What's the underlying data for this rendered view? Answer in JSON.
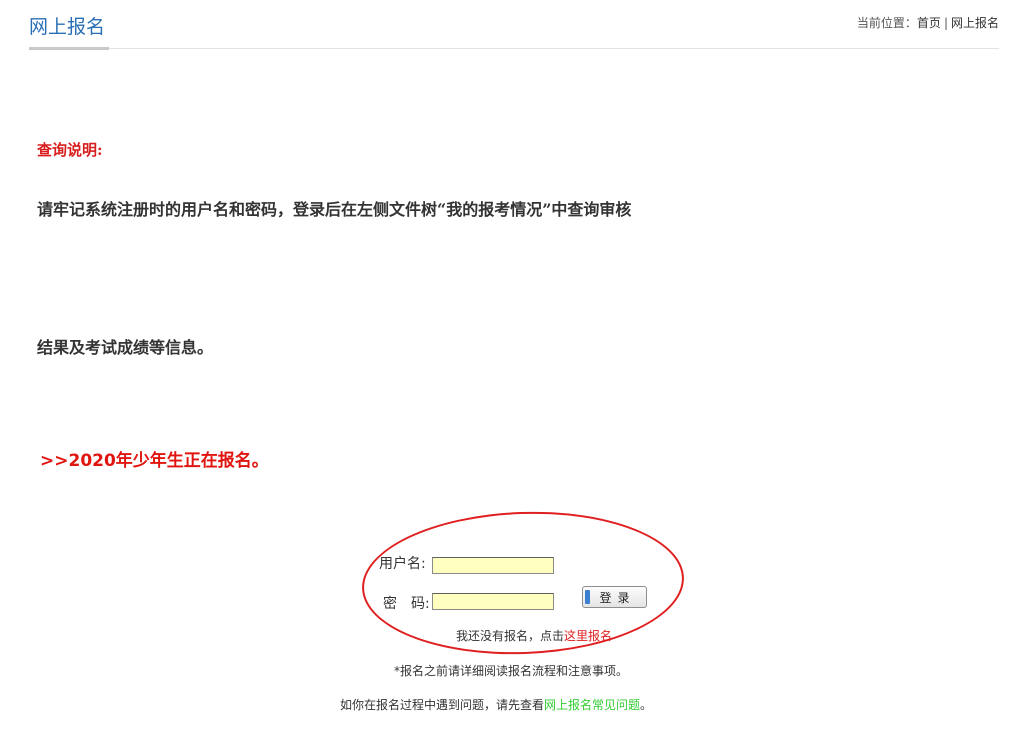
{
  "header": {
    "title": "网上报名",
    "breadcrumb_prefix": "当前位置：",
    "breadcrumb_home": "首页",
    "breadcrumb_sep": "|",
    "breadcrumb_current": "网上报名"
  },
  "notice": {
    "title": "查询说明:",
    "line1_bold": "请牢记系统注册时的用户名和密码，",
    "line1_rest": "登录后在左侧文件树“我的报考情况”中查询审核",
    "line2": "结果及考试成绩等信息。",
    "enroll": ">>2020年少年生正在报名。"
  },
  "login": {
    "username_label": "用户名:",
    "username_value": "",
    "password_label": "密　码:",
    "password_value": "",
    "login_button": "登录",
    "register_prefix": "我还没有报名，点击",
    "register_link": "这里报名",
    "read_tip": "*报名之前请详细阅读报名流程和注意事项。",
    "faq_prefix": "如你在报名过程中遇到问题，请先查看",
    "faq_link": "网上报名常见问题",
    "faq_suffix": "。"
  },
  "colors": {
    "title_blue": "#2a6fb5",
    "alert_red": "#e0150f",
    "input_bg": "#ffffc0",
    "faq_green": "#33cc33"
  }
}
